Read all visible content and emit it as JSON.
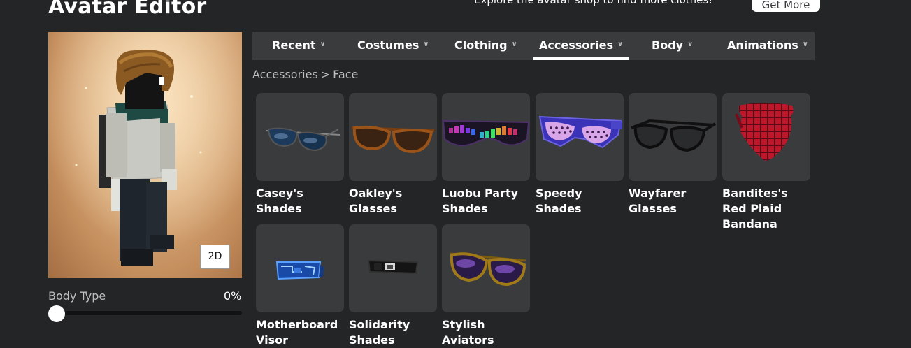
{
  "header": {
    "title": "Avatar Editor",
    "promo_text": "Explore the avatar shop to find more clothes!",
    "get_more_label": "Get More"
  },
  "preview": {
    "toggle_label": "2D"
  },
  "body_type": {
    "label": "Body Type",
    "value": "0%",
    "level": 0
  },
  "tabs": [
    {
      "label": "Recent",
      "active": false
    },
    {
      "label": "Costumes",
      "active": false
    },
    {
      "label": "Clothing",
      "active": false
    },
    {
      "label": "Accessories",
      "active": true
    },
    {
      "label": "Body",
      "active": false
    },
    {
      "label": "Animations",
      "active": false
    }
  ],
  "breadcrumb": {
    "parent": "Accessories",
    "separator": ">",
    "current": "Face"
  },
  "items": [
    {
      "name": "Casey's Shades",
      "icon": "aviator-sunglasses-icon"
    },
    {
      "name": "Oakley's Glasses",
      "icon": "brown-glasses-icon"
    },
    {
      "name": "Luobu Party Shades",
      "icon": "led-party-shades-icon"
    },
    {
      "name": "Speedy Shades",
      "icon": "shutter-shades-icon"
    },
    {
      "name": "Wayfarer Glasses",
      "icon": "wayfarer-glasses-icon"
    },
    {
      "name": "Bandites's Red Plaid Bandana",
      "icon": "plaid-bandana-icon"
    },
    {
      "name": "Motherboard Visor",
      "icon": "motherboard-visor-icon"
    },
    {
      "name": "Solidarity Shades",
      "icon": "solidarity-shades-icon"
    },
    {
      "name": "Stylish Aviators",
      "icon": "gold-aviators-icon"
    }
  ]
}
